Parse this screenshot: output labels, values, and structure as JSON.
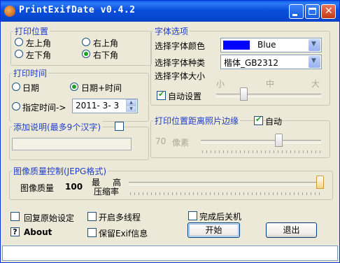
{
  "window": {
    "title": "PrintExifDate v0.4.2"
  },
  "titlebar_buttons": {
    "minimize": "minimize-icon",
    "maximize": "maximize-icon",
    "close": "close-icon"
  },
  "print_position": {
    "legend": "打印位置",
    "options": [
      "左上角",
      "右上角",
      "左下角",
      "右下角"
    ],
    "selected": "右下角"
  },
  "print_time": {
    "legend": "打印时间",
    "options": [
      "日期",
      "日期+时间",
      "指定时间->"
    ],
    "selected": "日期+时间",
    "date_value": "2011- 3- 3"
  },
  "description": {
    "legend": "添加说明(最多9个汉字)",
    "enabled": false,
    "text": ""
  },
  "font": {
    "legend": "字体选项",
    "color_label": "选择字体颜色",
    "color_value": "Blue",
    "color_hex": "#0000ff",
    "family_label": "选择字体种类",
    "family_value": "楷体_GB2312",
    "size_label": "选择字体大小",
    "size_marks": [
      "小",
      "中",
      "大"
    ],
    "size_level": 0.3,
    "auto_label": "自动设置",
    "auto_checked": true
  },
  "margin": {
    "legend": "打印位置距离照片边缘",
    "auto_label": "自动",
    "auto_checked": true,
    "value": "70",
    "unit": "像素",
    "level": 0.6
  },
  "quality": {
    "legend": "图像质量控制(JEPG格式)",
    "label": "图像质量",
    "value": "100",
    "side_top_left": "最",
    "side_top_right": "高",
    "side_bottom": "压缩率",
    "level": 1.0
  },
  "options": {
    "restore": "回复原始设定",
    "multithread": "开启多线程",
    "shutdown": "完成后关机",
    "keep_exif": "保留Exif信息",
    "about_icon": "?",
    "about": "About"
  },
  "buttons": {
    "start": "开始",
    "exit": "退出"
  },
  "status": {
    "text": ""
  }
}
